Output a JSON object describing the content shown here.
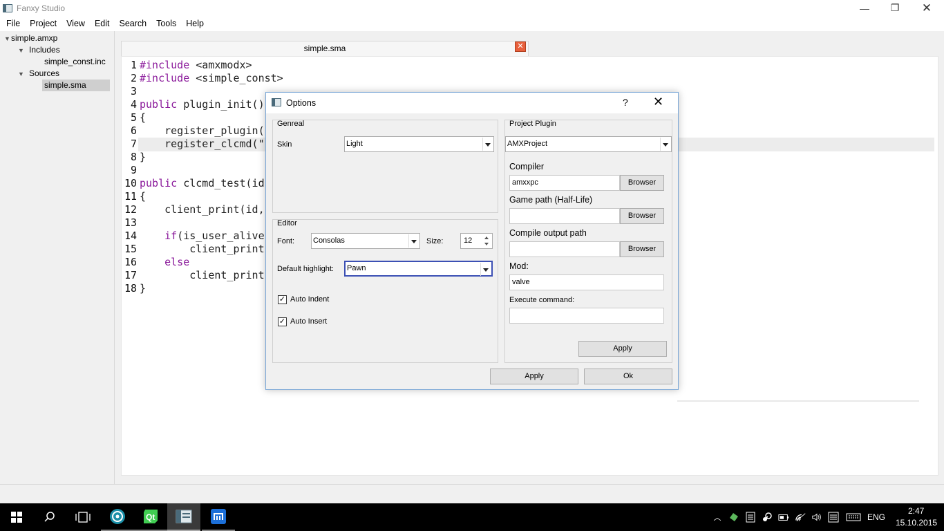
{
  "window": {
    "title": "Fanxy Studio",
    "minimize_glyph": "—",
    "restore_glyph": "❐",
    "close_glyph": "✕"
  },
  "menu": [
    "File",
    "Project",
    "View",
    "Edit",
    "Search",
    "Tools",
    "Help"
  ],
  "tree": {
    "project": "simple.amxp",
    "includes_folder": "Includes",
    "include_file": "simple_const.inc",
    "sources_folder": "Sources",
    "source_file": "simple.sma"
  },
  "editor": {
    "tab_label": "simple.sma",
    "tab_close_glyph": "✕",
    "lines": [
      {
        "n": "1",
        "kw": "#include",
        "rest": " <amxmodx>"
      },
      {
        "n": "2",
        "kw": "#include",
        "rest": " <simple_const>"
      },
      {
        "n": "3",
        "kw": "",
        "rest": ""
      },
      {
        "n": "4",
        "kw": "public",
        "rest": " plugin_init()"
      },
      {
        "n": "5",
        "kw": "",
        "rest": "{"
      },
      {
        "n": "6",
        "kw": "",
        "rest": "    register_plugin("
      },
      {
        "n": "7",
        "kw": "",
        "rest": "    register_clcmd(\""
      },
      {
        "n": "8",
        "kw": "",
        "rest": "}"
      },
      {
        "n": "9",
        "kw": "",
        "rest": ""
      },
      {
        "n": "10",
        "kw": "public",
        "rest": " clcmd_test(id"
      },
      {
        "n": "11",
        "kw": "",
        "rest": "{"
      },
      {
        "n": "12",
        "kw": "",
        "rest": "    client_print(id,"
      },
      {
        "n": "13",
        "kw": "",
        "rest": ""
      },
      {
        "n": "14",
        "kw_indent": "    ",
        "kw": "if",
        "rest": "(is_user_alive"
      },
      {
        "n": "15",
        "kw": "",
        "rest": "        client_print"
      },
      {
        "n": "16",
        "kw_indent": "    ",
        "kw": "else",
        "rest": ""
      },
      {
        "n": "17",
        "kw": "",
        "rest": "        client_print"
      },
      {
        "n": "18",
        "kw": "",
        "rest": "}"
      }
    ]
  },
  "dialog": {
    "title": "Options",
    "help_glyph": "?",
    "close_glyph": "✕",
    "general": {
      "title": "Genreal",
      "skin_label": "Skin",
      "skin_value": "Light"
    },
    "editor": {
      "title": "Editor",
      "font_label": "Font:",
      "font_value": "Consolas",
      "size_label": "Size:",
      "size_value": "12",
      "highlight_label": "Default highlight:",
      "highlight_value": "Pawn",
      "auto_indent_label": "Auto Indent",
      "auto_indent_checked": true,
      "auto_insert_label": "Auto Insert",
      "auto_insert_checked": true,
      "check_glyph": "✓"
    },
    "plugin": {
      "title": "Project Plugin",
      "plugin_value": "AMXProject",
      "compiler_label": "Compiler",
      "compiler_value": "amxxpc",
      "browse_label": "Browser",
      "game_path_label": "Game path (Half-Life)",
      "game_path_value": "",
      "output_path_label": "Compile output path",
      "output_path_value": "",
      "mod_label": "Mod:",
      "mod_value": "valve",
      "exec_label": "Execute command:",
      "exec_value": "",
      "apply_label": "Apply"
    },
    "apply_label": "Apply",
    "ok_label": "Ok"
  },
  "taskbar": {
    "language": "ENG",
    "time": "2:47",
    "date": "15.10.2015"
  },
  "colors": {
    "keyword": "#8b1a9b",
    "focus": "#3c50b4",
    "tab_close": "#e8603c"
  }
}
